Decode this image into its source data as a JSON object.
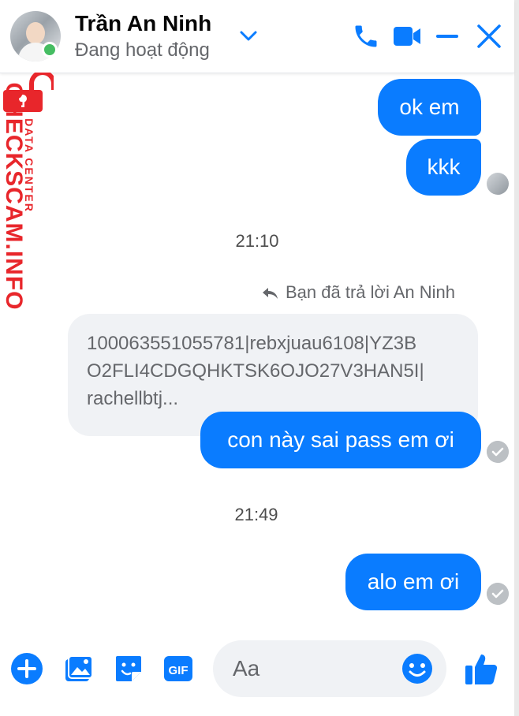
{
  "header": {
    "name": "Trần An Ninh",
    "status": "Đang hoạt động"
  },
  "watermark": {
    "brand": "CHECKSCAM.INFO",
    "tagline": "DATA CENTER"
  },
  "messages": [
    {
      "type": "outgoing",
      "text": "ok em"
    },
    {
      "type": "outgoing",
      "text": "kkk"
    },
    {
      "type": "time",
      "text": "21:10"
    },
    {
      "type": "reply-label",
      "text": "Bạn đã trả lời An Ninh"
    },
    {
      "type": "quoted",
      "lines": [
        "100063551055781|rebxjuau6108|YZ3B",
        "O2FLI4CDGQHKTSK6OJO27V3HAN5I|",
        "rachellbtj..."
      ]
    },
    {
      "type": "outgoing",
      "text": "con này sai pass em ơi"
    },
    {
      "type": "time",
      "text": "21:49"
    },
    {
      "type": "outgoing",
      "text": "alo em ơi"
    }
  ],
  "composer": {
    "placeholder": "Aa",
    "gif_label": "GIF"
  },
  "colors": {
    "accent": "#0a7cff",
    "online": "#45bd62",
    "watermark": "#e8262b"
  }
}
